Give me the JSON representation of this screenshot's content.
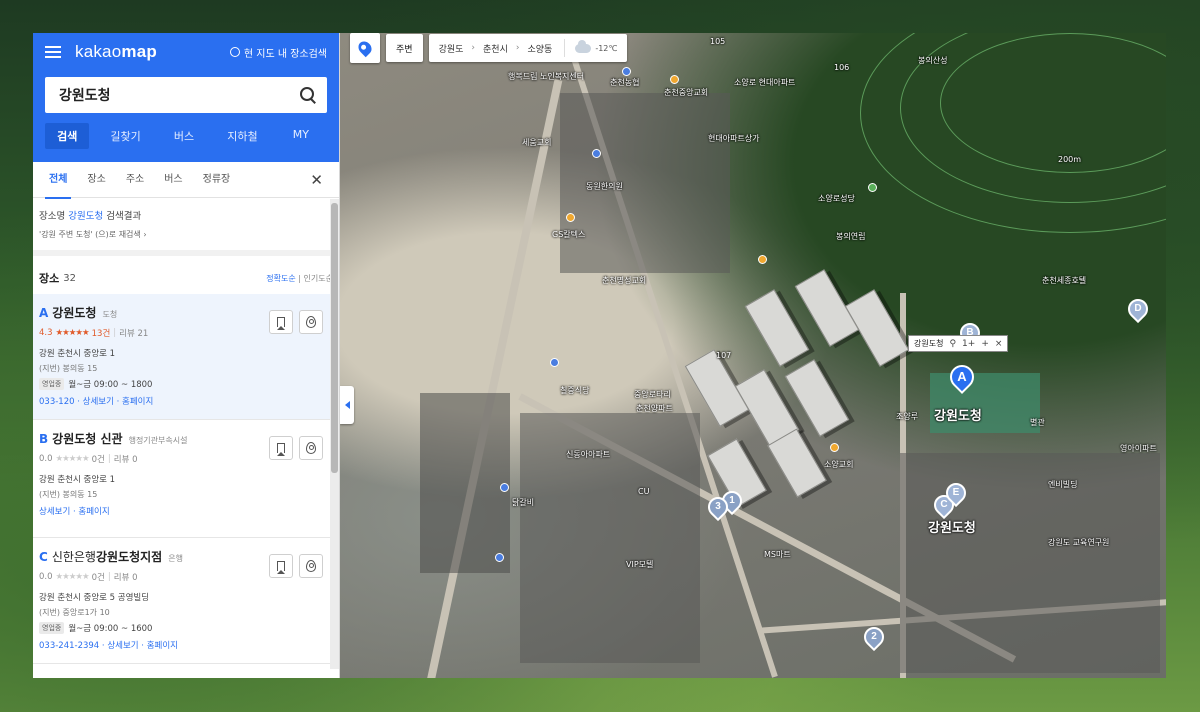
{
  "app": {
    "logo_light": "kakao",
    "logo_bold": "map",
    "here_search": "현 지도 내 장소검색"
  },
  "search": {
    "query": "강원도청"
  },
  "mode_tabs": [
    "검색",
    "길찾기",
    "버스",
    "지하철",
    "MY"
  ],
  "sub_tabs": [
    "전체",
    "장소",
    "주소",
    "버스",
    "정류장"
  ],
  "result_info": {
    "prefix": "장소명 ",
    "highlight": "강원도청",
    "suffix": " 검색결과",
    "retry": "'강원 주변 도청' (으)로 재검색 ›"
  },
  "list": {
    "title": "장소",
    "count": "32",
    "sort_accuracy": "정확도순",
    "sort_divider": "|",
    "sort_popular": "인기도순"
  },
  "places": [
    {
      "letter": "A",
      "name_pre": "",
      "name": "강원도청",
      "category": "도청",
      "score": "4.3",
      "stars": "★★★★★",
      "count": "13건",
      "review": "리뷰 21",
      "address": "강원 춘천시 중앙로 1",
      "jibun": "(지번) 봉의동 15",
      "hours_badge": "영업중",
      "hours": "월~금 09:00 ~ 1800",
      "phone": "033-120",
      "detail": "상세보기",
      "homepage": "홈페이지"
    },
    {
      "letter": "B",
      "name_pre": "",
      "name": "강원도청 신관",
      "category": "행정기관부속시설",
      "score": "0.0",
      "stars": "★★★★★",
      "count": "0건",
      "review": "리뷰 0",
      "address": "강원 춘천시 중앙로 1",
      "jibun": "(지번) 봉의동 15",
      "detail": "상세보기",
      "homepage": "홈페이지"
    },
    {
      "letter": "C",
      "name_pre": "신한은행 ",
      "name": "강원도청지점",
      "category": "은행",
      "score": "0.0",
      "stars": "★★★★★",
      "count": "0건",
      "review": "리뷰 0",
      "address": "강원 춘천시 중앙로 5 공영빌딩",
      "jibun": "(지번) 중앙로1가 10",
      "hours_badge": "영업중",
      "hours": "월~금 09:00 ~ 1600",
      "phone": "033-241-2394",
      "detail": "상세보기",
      "homepage": "홈페이지"
    }
  ],
  "map": {
    "around_btn": "주변",
    "crumbs": [
      "강원도",
      "춘천시",
      "소양동"
    ],
    "temperature": "-12℃",
    "popup_title": "강원도청",
    "popup_icons": [
      "⚲",
      "1+",
      "+",
      "×"
    ],
    "big_label_1": "강원도청",
    "big_label_2": "강원도청",
    "markers": [
      "A",
      "B",
      "C",
      "D",
      "E",
      "1",
      "2",
      "3"
    ],
    "labels": [
      "행복드림 노인복지센터",
      "춘천중앙교회",
      "소양로 현대아파트",
      "세움교회",
      "춘천농협",
      "동원한의원",
      "현대아파트상가",
      "GS칼텍스",
      "소양로성당",
      "봉의연립",
      "춘천명성교회",
      "춘천세종호텔",
      "칠중식당",
      "중앙로타리",
      "소양교회",
      "춘천양파트",
      "신동아아파트",
      "조양루",
      "별관",
      "영아이파트",
      "닭갈비",
      "CU",
      "VIP모텔",
      "MS마트",
      "엔비빌딩",
      "강원도 교육연구원",
      "봉의산성",
      "200m",
      "105",
      "106",
      "107"
    ]
  },
  "colors": {
    "brand": "#2a6ff0",
    "star": "#e05a2a"
  }
}
